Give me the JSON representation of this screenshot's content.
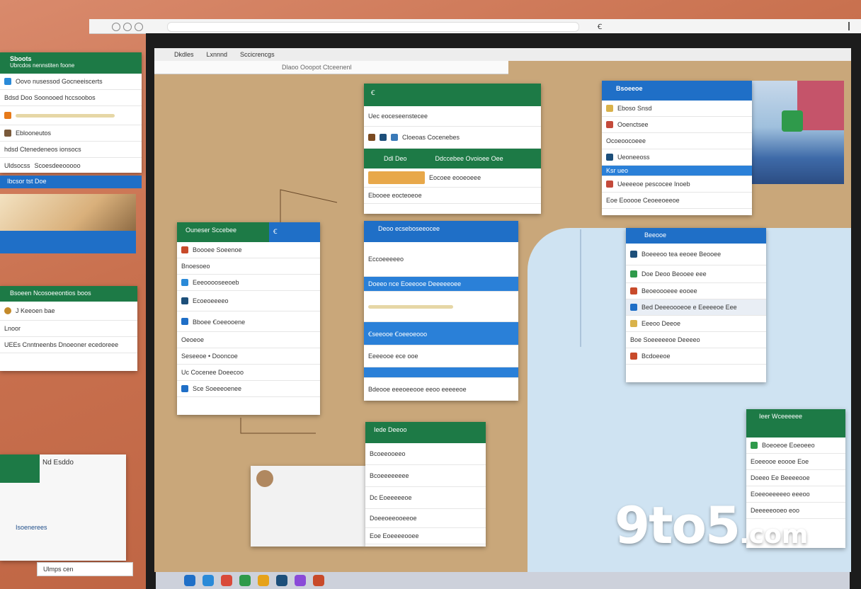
{
  "browser": {
    "url_text": "Ꞓ",
    "address_text": "",
    "right_text": ""
  },
  "desktop_inner": {
    "menu_items": [
      "Dkdles",
      "Lxnnnd",
      "Sccicrencgs"
    ],
    "address": "Dlaoo Ooopot Ctceenenl"
  },
  "left_win1": {
    "title": "Sboots",
    "subtitle": "Ubrcdos nennstiten foone",
    "rows": [
      "Oovo nusessod Gocneeiscerts",
      "Bdsd Doo Soonooed hccsoobos",
      "Eblooneutos",
      "hdsd Ctenedeneos ionsocs"
    ],
    "footer": [
      "Uldsocss",
      "Scoesdeeooooo"
    ],
    "blue_text": "Ibcsor tst Doe"
  },
  "left_win2": {
    "title": "Bsoeen Ncosoeeontios boos",
    "row1": "J Keeoen bae",
    "row2": "Lnoor",
    "row3": "UEEs Cnntneenbs Dnoeoner ecedoreee"
  },
  "left_win3": {
    "title": "Nd Esddo",
    "row": "Isoenerees",
    "search": "Ulmps cen"
  },
  "win_top_green": {
    "title": "Ꞓ",
    "head_rows": [
      "Uec eoceseenstecee",
      "Cloeoas Cocenebes"
    ],
    "section": [
      "Ddl Deo",
      "Ddccebee Ovoioee Oee"
    ],
    "rows": [
      "Eocoee eooeoeee",
      "Ebooee eocteoeoe"
    ]
  },
  "win_top_blue": {
    "title": "Bsoeeoe",
    "rows": [
      "Eboso Snsd",
      "Ooenctsee",
      "Ocoeoocoeee",
      "Ueoneeoss",
      "Ksr ueo",
      "Ueeeeoe pescocee Inoeb",
      "Eoe Eooooe Ceoeeoeeoe"
    ]
  },
  "win_mid_left": {
    "title": "Ouneser Sccebee",
    "tab": "Ꞓ",
    "rows": [
      "Boooee Soeenoe",
      "Bnoesoeo",
      "Eeeooooseeoeb",
      "Ecoeoeeeeo",
      "Bboee Ꞓoeeooene",
      "Oeoeoe",
      "Seseeoe • Dooncoe",
      "Uc Cocenee Doeecoo",
      "Sce Soeeeoenee"
    ]
  },
  "win_mid_center": {
    "title": "Deoo ecseboseeocee",
    "rows": [
      "Doeeo nce Eoeeooe Deeeeeoee",
      "Eccoeeeeeo",
      "Ꞓseeooe Ꞓoeeoeooo",
      "Eeeeooe ece ooe",
      "Bdeooe eeeoeeooe eeoo eeeeeoe"
    ]
  },
  "win_mid_right": {
    "title": "Beeooe",
    "rows": [
      "Boeeeoo tea eeoee Beooee",
      "Doe Deoo Beooee eee",
      "Beoeoooeee eooee",
      "Bed Deeeoooeoe e Eeeeeoe Eee",
      "Eeeoo Deeoe",
      "Boe Soeeeeeoe Deeeeo",
      "Bcdoeeoe"
    ]
  },
  "win_bottom_center": {
    "title": "Iede Deeoo",
    "rows": [
      "Bcoeeeeeeee",
      "Dc Eoeeeeeoe",
      "Doeeoeeooeeoe",
      "Eoe Eoeeeeooee"
    ],
    "sub": "Bcoeeooeeo"
  },
  "win_bottom_right": {
    "title": "Ieer Wceeeeee",
    "rows": [
      "Boeoeoe Eoeoeeo",
      "Eoeeooe eoooe Eoe",
      "Doeeo Ee Beeeeooe",
      "Eoeeoeeeeeo eeeoo",
      "Deeeeeooeo eoo"
    ]
  },
  "watermark": {
    "brand": "9to5",
    "suffix": ".com"
  },
  "colors": {
    "accent_green": "#1d7a46",
    "accent_blue": "#1f6fc7",
    "board": "#c9a77a",
    "water": "#cfe3f2"
  }
}
